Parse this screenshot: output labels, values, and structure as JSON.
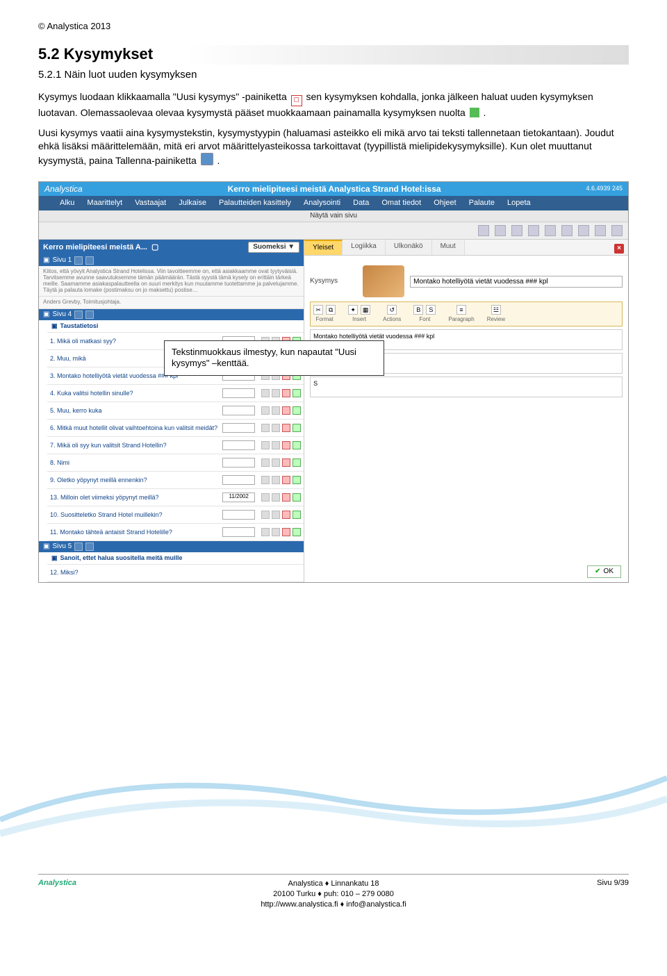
{
  "copyright": "© Analystica 2013",
  "h1": "5.2  Kysymykset",
  "h2": "5.2.1  Näin luot uuden kysymyksen",
  "para1a": "Kysymys luodaan klikkaamalla \"Uusi kysymys\" -painiketta ",
  "para1b": " sen kysymyksen kohdalla, jonka jälkeen haluat uuden kysymyksen luotavan. Olemassaolevaa olevaa kysymystä pääset muokkaamaan painamalla kysymyksen nuolta ",
  "para1c": ".",
  "para2a": "Uusi kysymys vaatii aina kysymystekstin, kysymystyypin (haluamasi asteikko eli mikä arvo tai teksti tallennetaan tietokantaan). Joudut ehkä lisäksi määrittelemään, mitä eri arvot määrittelyasteikossa tarkoittavat (tyypillistä mielipidekysymyksille). Kun olet muuttanut kysymystä, paina Tallenna-painiketta ",
  "para2b": ".",
  "callout": "Tekstinmuokkaus ilmestyy, kun napautat \"Uusi kysymys\" –kenttää.",
  "app": {
    "brand": "Analystica",
    "title": "Kerro mielipiteesi meistä Analystica Strand Hotel:issa",
    "version": "4.6.4939 245",
    "menu": [
      "Alku",
      "Maarittelyt",
      "Vastaajat",
      "Julkaise",
      "Palautteiden kasittely",
      "Analysointi",
      "Data",
      "Omat tiedot",
      "Ohjeet",
      "Palaute",
      "Lopeta"
    ],
    "subbar": "Näytä vain sivu",
    "surveytitle": "Kerro mielipiteesi meistä A...",
    "lang": "Suomeksi ▼",
    "page1": "Sivu 1",
    "page4": "Sivu 4",
    "page5": "Sivu 5",
    "intro": "Kiitos, että yövyit Analystica Strand Hotelissa. Viin tavoitteemme on, että asiakkaamme ovat tyytyväisiä. Tarvitsemme avunne saavutuksemme tämän päämäärän. Tästä syystä tämä kysely on erittäin tärkeä meille. Saamamme asiakaspalautteella on suuri merkitys kun muutamme tuotettamme ja palvelujamme. Täytä ja palauta lomake (postimaksu on jo maksettu) postise…",
    "taustatietosi": "Taustatietosi",
    "sanoit": "Sanoit, ettet halua suositella meitä muille",
    "questions": [
      "1. Mikä oli matkasi syy?",
      "2. Muu, mikä",
      "3. Montako hotelliyötä vietät vuodessa ### kpl",
      "4. Kuka valitsi hotellin sinulle?",
      "5. Muu, kerro kuka",
      "6. Mitkä muut hotellit olivat vaihtoehtoina kun valitsit meidät?",
      "7. Mikä oli syy kun valitsit Strand Hotellin?",
      "8. Nimi",
      "9. Oletko yöpynyt meillä ennenkin?",
      "13. Milloin olet viimeksi yöpynyt meillä?",
      "10. Suositteletko Strand Hotel muillekin?",
      "11. Montako tähteä antaisit Strand Hotelille?"
    ],
    "q12": "12. Miksi?",
    "dateval": "11/2002",
    "tabs": [
      "Yleiset",
      "Logiikka",
      "Ulkonäkö",
      "Muut"
    ],
    "field_kysymys": "Kysymys",
    "field_kysymys_val": "Montako hotelliyötä vietät vuodessa ### kpl",
    "editor_groups": [
      "Format",
      "Insert",
      "Actions",
      "Font",
      "Paragraph",
      "Review"
    ],
    "editor_text": "Montako hotelliyötä vietät vuodessa ### kpl",
    "ok": "OK",
    "signoff": "Anders Grevby, Toimitusjohtaja."
  },
  "footer": {
    "brand": "Analystica",
    "line1": "Analystica ♦ Linnankatu 18",
    "line2": "20100 Turku ♦ puh: 010 – 279 0080",
    "line3": "http://www.analystica.fi ♦ info@analystica.fi",
    "pageno": "Sivu 9/39"
  }
}
